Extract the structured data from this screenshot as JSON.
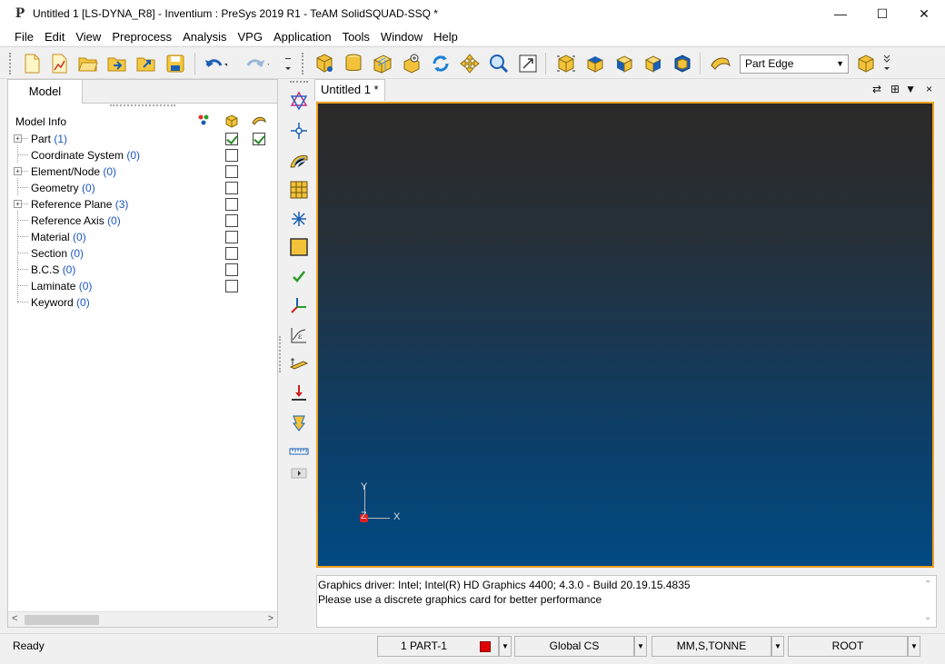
{
  "window": {
    "app_icon": "P",
    "title": "Untitled 1 [LS-DYNA_R8] - Inventium : PreSys 2019 R1 - TeAM SolidSQUAD-SSQ *",
    "min": "—",
    "max": "☐",
    "close": "✕"
  },
  "menu": [
    "File",
    "Edit",
    "View",
    "Preprocess",
    "Analysis",
    "VPG",
    "Application",
    "Tools",
    "Window",
    "Help"
  ],
  "toolbar": {
    "selection_mode": "Part Edge"
  },
  "left_panel": {
    "tab": "Model",
    "header": "Model Info",
    "items": [
      {
        "name": "Part",
        "count": "(1)",
        "expandable": true,
        "check1": true,
        "check2": true
      },
      {
        "name": "Coordinate System",
        "count": "(0)",
        "expandable": false,
        "check1": false,
        "check2": null
      },
      {
        "name": "Element/Node",
        "count": "(0)",
        "expandable": true,
        "check1": false,
        "check2": null
      },
      {
        "name": "Geometry",
        "count": "(0)",
        "expandable": false,
        "check1": false,
        "check2": null
      },
      {
        "name": "Reference Plane",
        "count": "(3)",
        "expandable": true,
        "check1": false,
        "check2": null
      },
      {
        "name": "Reference Axis",
        "count": "(0)",
        "expandable": false,
        "check1": false,
        "check2": null
      },
      {
        "name": "Material",
        "count": "(0)",
        "expandable": false,
        "check1": false,
        "check2": null
      },
      {
        "name": "Section",
        "count": "(0)",
        "expandable": false,
        "check1": false,
        "check2": null
      },
      {
        "name": "B.C.S",
        "count": "(0)",
        "expandable": false,
        "check1": false,
        "check2": null
      },
      {
        "name": "Laminate",
        "count": "(0)",
        "expandable": false,
        "check1": false,
        "check2": null
      },
      {
        "name": "Keyword",
        "count": "(0)",
        "expandable": false,
        "check1": null,
        "check2": null
      }
    ]
  },
  "document": {
    "tab": "Untitled 1 *",
    "controls": [
      "⇄",
      "⊞",
      "▼",
      "×"
    ]
  },
  "viewport": {
    "axis_y": "Y",
    "axis_z": "Z",
    "axis_x": "X"
  },
  "console": {
    "lines": [
      "Graphics driver: Intel; Intel(R) HD Graphics 4400; 4.3.0 - Build 20.19.15.4835",
      "Please use a discrete graphics card for better performance"
    ]
  },
  "status": {
    "text": "Ready",
    "part": "1 PART-1",
    "cs": "Global CS",
    "units": "MM,S,TONNE",
    "root": "ROOT",
    "part_color": "#e00000"
  }
}
